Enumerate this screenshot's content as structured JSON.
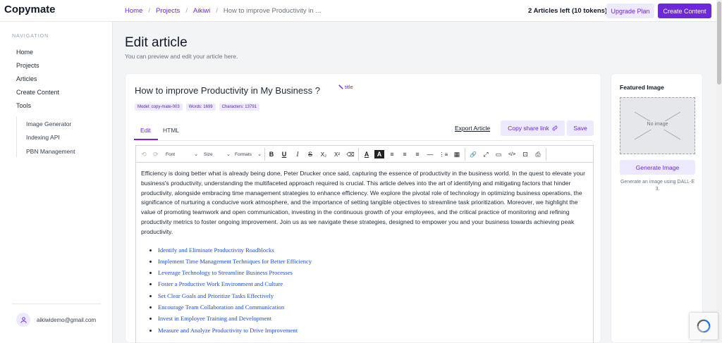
{
  "app": {
    "name": "Copymate"
  },
  "breadcrumb": [
    "Home",
    "Projects",
    "Aikiwi",
    "How to improve Productivity in ..."
  ],
  "header": {
    "credits": "2 Articles left (10 tokens)",
    "upgrade_label": "Upgrade Plan",
    "create_label": "Create Content"
  },
  "sidebar": {
    "heading": "NAVIGATION",
    "items": [
      "Home",
      "Projects",
      "Articles",
      "Create Content",
      "Tools"
    ],
    "tools": [
      "Image Generator",
      "Indexing API",
      "PBN Management"
    ],
    "user_email": "aikiwidemo@gmail.com"
  },
  "page": {
    "title": "Edit article",
    "subtitle": "You can preview and edit your article here."
  },
  "article": {
    "title": "How to improve Productivity in My Business ?",
    "title_hint": "title",
    "badges": [
      "Model: copy-mate-003",
      "Words: 1699",
      "Characters: 13791"
    ],
    "tabs": [
      "Edit",
      "HTML"
    ],
    "export_label": "Export Article",
    "share_label": "Copy share link",
    "save_label": "Save",
    "intro": "Efficiency is doing better what is already being done, Peter Drucker once said, capturing the essence of productivity in the business world. In the quest to elevate your business's productivity, understanding the multifaceted approach required is crucial. This article delves into the art of identifying and mitigating factors that hinder productivity, alongside embracing time management strategies to enhance efficiency. We explore the pivotal role of technology in optimizing business operations, the significance of nurturing a conducive work atmosphere, and the importance of setting tangible objectives to streamline task prioritization. Moreover, we highlight the value of promoting teamwork and open communication, investing in the continuous growth of your employees, and the critical practice of monitoring and refining productivity metrics to foster ongoing improvement. Join us as we navigate these strategies, designed to empower you and your business towards achieving peak productivity.",
    "outline": [
      "Identify and Eliminate Productivity Roadblocks",
      "Implement Time Management Techniques for Better Efficiency",
      "Leverage Technology to Streamline Business Processes",
      "Foster a Productive Work Environment and Culture",
      "Set Clear Goals and Prioritize Tasks Effectively",
      "Encourage Team Collaboration and Communication",
      "Invest in Employee Training and Development",
      "Measure and Analyze Productivity to Drive Improvement"
    ]
  },
  "toolbar": {
    "font_label": "Font",
    "size_label": "Size",
    "formats_label": "Formats",
    "buttons": [
      {
        "name": "bold-button",
        "glyph": "B"
      },
      {
        "name": "underline-button",
        "glyph": "U"
      },
      {
        "name": "italic-button",
        "glyph": "I"
      },
      {
        "name": "strikethrough-button",
        "glyph": "S"
      },
      {
        "name": "subscript-button",
        "glyph": "X₂"
      },
      {
        "name": "superscript-button",
        "glyph": "X²"
      },
      {
        "name": "clear-format-button",
        "glyph": "⌫"
      },
      {
        "name": "text-color-button",
        "glyph": "A"
      },
      {
        "name": "highlight-color-button",
        "glyph": "A"
      },
      {
        "name": "align-center-button",
        "glyph": "≡"
      },
      {
        "name": "align-right-button",
        "glyph": "≡"
      },
      {
        "name": "align-left-button",
        "glyph": "≡"
      },
      {
        "name": "horizontal-rule-button",
        "glyph": "—"
      },
      {
        "name": "ordered-list-button",
        "glyph": "⋮≡"
      },
      {
        "name": "table-button",
        "glyph": "▦"
      },
      {
        "name": "link-button",
        "glyph": "🔗"
      },
      {
        "name": "fullscreen-button",
        "glyph": "⤢"
      },
      {
        "name": "template-button",
        "glyph": "▭"
      },
      {
        "name": "code-view-button",
        "glyph": "</>"
      },
      {
        "name": "preview-button",
        "glyph": "⊡"
      },
      {
        "name": "print-button",
        "glyph": "⎙"
      }
    ]
  },
  "featured": {
    "title": "Featured Image",
    "placeholder": "No image",
    "generate_label": "Generate Image",
    "hint": "Generate an image using DALL-E 3."
  },
  "colors": {
    "accent": "#6d28d9",
    "accent_light": "#ede9fe",
    "link": "#1d4ed8"
  }
}
